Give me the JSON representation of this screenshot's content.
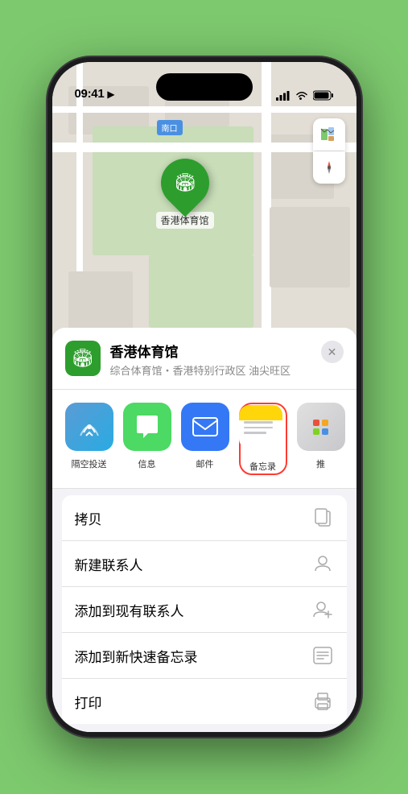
{
  "status_bar": {
    "time": "09:41",
    "location_arrow": true
  },
  "map": {
    "label_text": "南口"
  },
  "map_controls": {
    "map_icon": "🗺",
    "location_icon": "↗"
  },
  "venue": {
    "name": "香港体育馆",
    "description": "综合体育馆・香港特别行政区 油尖旺区",
    "pin_label": "香港体育馆"
  },
  "share_actions": [
    {
      "id": "airdrop",
      "label": "隔空投送",
      "type": "airdrop"
    },
    {
      "id": "messages",
      "label": "信息",
      "type": "messages"
    },
    {
      "id": "mail",
      "label": "邮件",
      "type": "mail"
    },
    {
      "id": "notes",
      "label": "备忘录",
      "type": "notes"
    },
    {
      "id": "more",
      "label": "推",
      "type": "more"
    }
  ],
  "menu_items": [
    {
      "id": "copy",
      "label": "拷贝",
      "icon": "copy"
    },
    {
      "id": "new-contact",
      "label": "新建联系人",
      "icon": "person"
    },
    {
      "id": "add-to-contact",
      "label": "添加到现有联系人",
      "icon": "person-add"
    },
    {
      "id": "quick-note",
      "label": "添加到新快速备忘录",
      "icon": "note"
    },
    {
      "id": "print",
      "label": "打印",
      "icon": "printer"
    }
  ],
  "close_button_label": "✕"
}
